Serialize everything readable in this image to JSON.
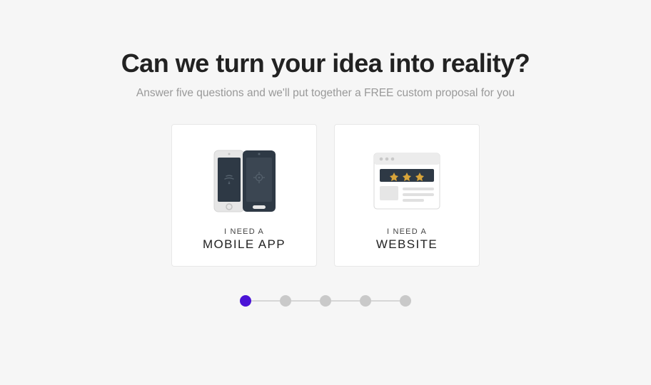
{
  "title": "Can we turn your idea into reality?",
  "subtitle": "Answer five questions and we'll put together a FREE custom proposal for you",
  "cards": [
    {
      "small": "I NEED A",
      "big": "MOBILE APP",
      "icon": "mobile-app"
    },
    {
      "small": "I NEED A",
      "big": "WEBSITE",
      "icon": "website"
    }
  ],
  "progress": {
    "total": 5,
    "current": 1
  },
  "colors": {
    "accent": "#4a13d6",
    "dark": "#2e3945",
    "light": "#e6e6e6"
  }
}
